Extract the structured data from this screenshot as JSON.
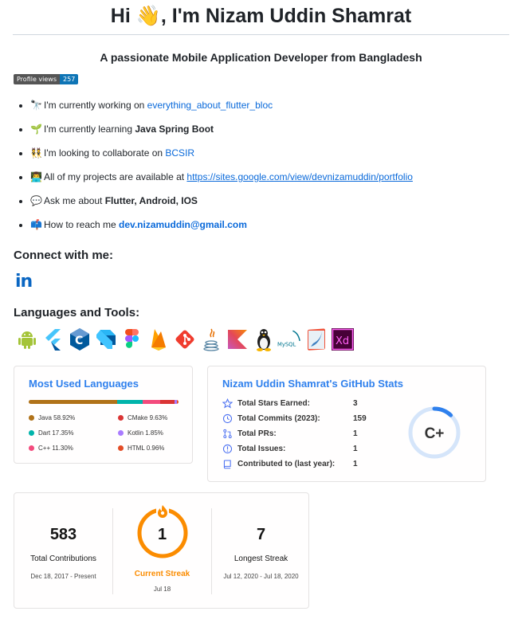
{
  "header": {
    "title": "Hi 👋, I'm Nizam Uddin Shamrat",
    "subtitle": "A passionate Mobile Application Developer from Bangladesh"
  },
  "badge": {
    "label": "Profile views",
    "count": "257"
  },
  "bullets": [
    {
      "emoji": "🔭",
      "text": "I'm currently working on ",
      "link": "everything_about_flutter_bloc"
    },
    {
      "emoji": "🌱",
      "text": "I'm currently learning ",
      "bold": "Java Spring Boot"
    },
    {
      "emoji": "👯",
      "text": "I'm looking to collaborate on ",
      "link": "BCSIR"
    },
    {
      "emoji": "👨‍💻",
      "text": "All of my projects are available at ",
      "link": "https://sites.google.com/view/devnizamuddin/portfolio"
    },
    {
      "emoji": "💬",
      "text": "Ask me about ",
      "bold": "Flutter, Android, IOS"
    },
    {
      "emoji": "📫",
      "text": "How to reach me ",
      "link": "dev.nizamuddin@gmail.com"
    }
  ],
  "connect": {
    "heading": "Connect with me:",
    "linkedin_icon": "in"
  },
  "tools": {
    "heading": "Languages and Tools:",
    "icons": [
      "android-icon",
      "flutter-icon",
      "cplusplus-icon",
      "dart-icon",
      "figma-icon",
      "firebase-icon",
      "git-icon",
      "java-icon",
      "kotlin-icon",
      "linux-icon",
      "mysql-icon",
      "swift-icon",
      "xd-icon"
    ],
    "mysql_text": "MySQL",
    "xd_text": "Xd",
    "cpp_text": "C"
  },
  "languages_card": {
    "title": "Most Used Languages",
    "items": [
      {
        "name": "Java",
        "percent": "58.92%",
        "value": 58.92,
        "color": "#b07219"
      },
      {
        "name": "CMake",
        "percent": "9.63%",
        "value": 9.63,
        "color": "#DA3434"
      },
      {
        "name": "Dart",
        "percent": "17.35%",
        "value": 17.35,
        "color": "#00B4AB"
      },
      {
        "name": "Kotlin",
        "percent": "1.85%",
        "value": 1.85,
        "color": "#A97BFF"
      },
      {
        "name": "C++",
        "percent": "11.30%",
        "value": 11.3,
        "color": "#f34b7d"
      },
      {
        "name": "HTML",
        "percent": "0.96%",
        "value": 0.96,
        "color": "#e34c26"
      }
    ]
  },
  "stats_card": {
    "title": "Nizam Uddin Shamrat's GitHub Stats",
    "rows": [
      {
        "label": "Total Stars Earned:",
        "value": "3",
        "icon": "star-icon"
      },
      {
        "label": "Total Commits (2023):",
        "value": "159",
        "icon": "history-icon"
      },
      {
        "label": "Total PRs:",
        "value": "1",
        "icon": "pull-request-icon"
      },
      {
        "label": "Total Issues:",
        "value": "1",
        "icon": "issue-icon"
      },
      {
        "label": "Contributed to (last year):",
        "value": "1",
        "icon": "repo-icon"
      }
    ],
    "grade": "C+",
    "grade_fill": 0.12,
    "ring_color": "#2f80ed"
  },
  "streak_card": {
    "total": {
      "value": "583",
      "label": "Total Contributions",
      "range": "Dec 18, 2017 - Present"
    },
    "current": {
      "value": "1",
      "label": "Current Streak",
      "range": "Jul 18"
    },
    "longest": {
      "value": "7",
      "label": "Longest Streak",
      "range": "Jul 12, 2020 - Jul 18, 2020"
    },
    "accent": "#fb8c00"
  }
}
